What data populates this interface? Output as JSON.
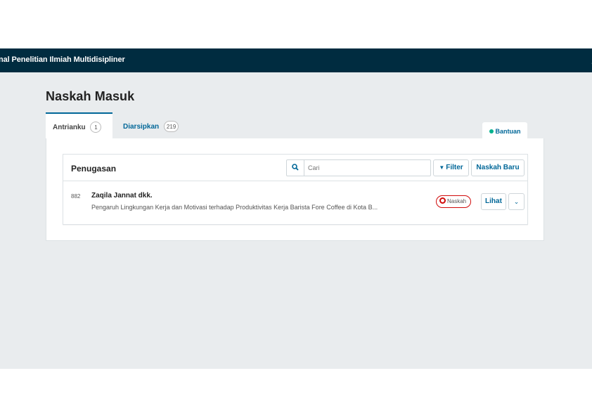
{
  "header": {
    "journal_title": "nal Penelitian Ilmiah Multidisipliner",
    "user_icon": "user-icon"
  },
  "main": {
    "page_title": "Naskah Masuk",
    "tabs": [
      {
        "label": "Antrianku",
        "count": "1"
      },
      {
        "label": "Diarsipkan",
        "count": "219"
      }
    ],
    "help_label": "Bantuan"
  },
  "assignments": {
    "title": "Penugasan",
    "search_placeholder": "Cari",
    "filter_label": "Filter",
    "new_submission_label": "Naskah Baru",
    "items": [
      {
        "id": "882",
        "author": "Zaqila Jannat dkk.",
        "title": "Pengaruh Lingkungan Kerja dan Motivasi terhadap Produktivitas Kerja Barista Fore Coffee di Kota B...",
        "stage": "Naskah",
        "view_label": "Lihat"
      }
    ]
  },
  "colors": {
    "nav": "#002c40",
    "accent": "#006798",
    "stage": "#d00a0a",
    "page_bg": "#e9ecee"
  }
}
